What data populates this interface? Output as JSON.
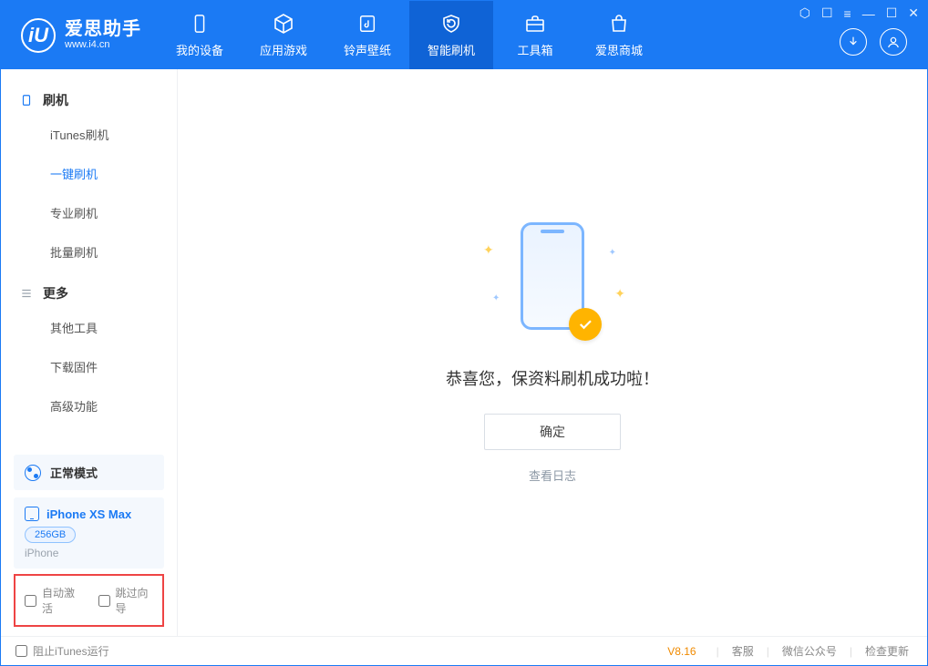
{
  "brand": {
    "cn": "爱思助手",
    "en": "www.i4.cn",
    "mark": "iU"
  },
  "tabs": [
    {
      "label": "我的设备"
    },
    {
      "label": "应用游戏"
    },
    {
      "label": "铃声壁纸"
    },
    {
      "label": "智能刷机"
    },
    {
      "label": "工具箱"
    },
    {
      "label": "爱思商城"
    }
  ],
  "sidebar": {
    "group_flash": "刷机",
    "items_flash": [
      "iTunes刷机",
      "一键刷机",
      "专业刷机",
      "批量刷机"
    ],
    "group_more": "更多",
    "items_more": [
      "其他工具",
      "下载固件",
      "高级功能"
    ]
  },
  "mode": {
    "label": "正常模式"
  },
  "device": {
    "name": "iPhone XS Max",
    "capacity": "256GB",
    "type": "iPhone"
  },
  "options": {
    "auto_activate": "自动激活",
    "skip_guide": "跳过向导"
  },
  "main": {
    "success": "恭喜您，保资料刷机成功啦！",
    "ok": "确定",
    "view_log": "查看日志"
  },
  "footer": {
    "block_itunes": "阻止iTunes运行",
    "version": "V8.16",
    "links": [
      "客服",
      "微信公众号",
      "检查更新"
    ]
  }
}
